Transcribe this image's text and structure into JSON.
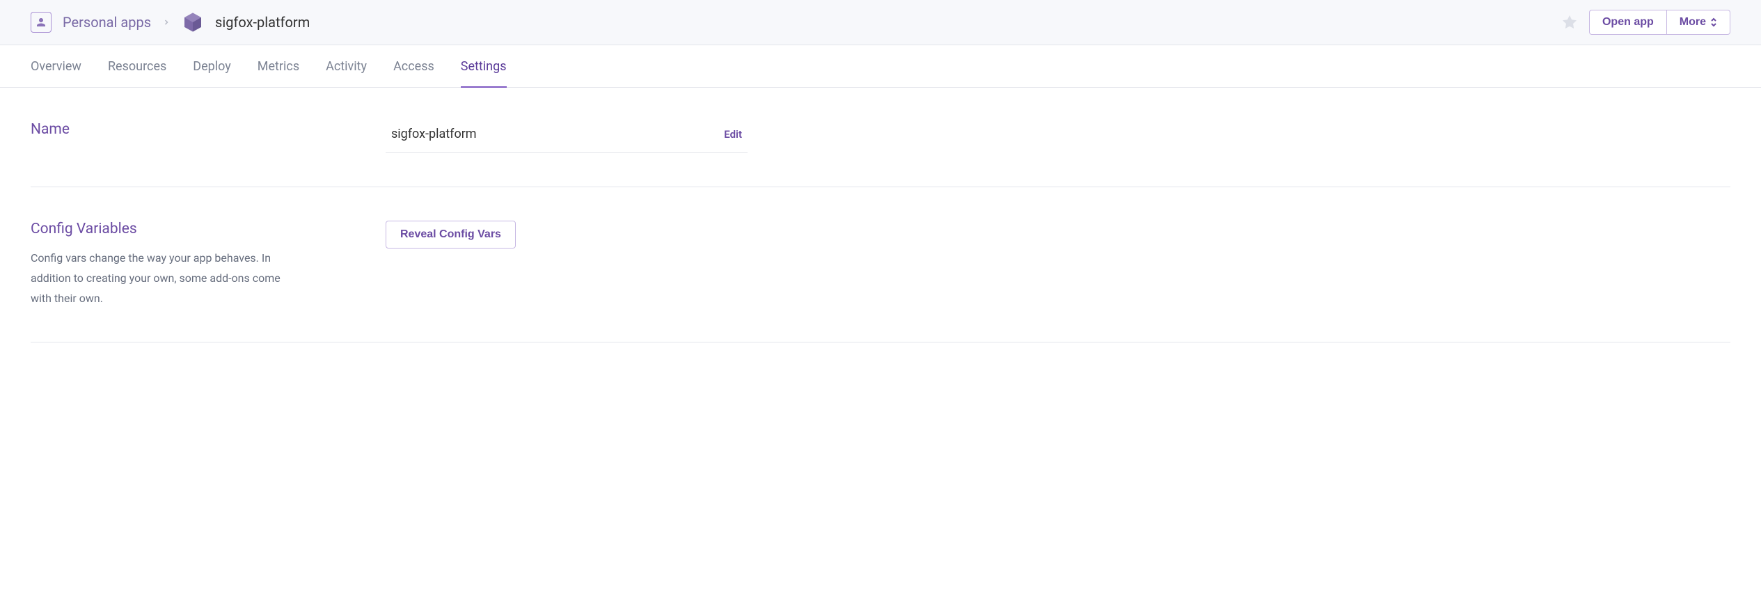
{
  "header": {
    "breadcrumb": {
      "personal_label": "Personal apps",
      "app_name": "sigfox-platform"
    },
    "actions": {
      "open_app_label": "Open app",
      "more_label": "More"
    }
  },
  "tabs": [
    {
      "label": "Overview",
      "active": false
    },
    {
      "label": "Resources",
      "active": false
    },
    {
      "label": "Deploy",
      "active": false
    },
    {
      "label": "Metrics",
      "active": false
    },
    {
      "label": "Activity",
      "active": false
    },
    {
      "label": "Access",
      "active": false
    },
    {
      "label": "Settings",
      "active": true
    }
  ],
  "sections": {
    "name": {
      "title": "Name",
      "value": "sigfox-platform",
      "edit_label": "Edit"
    },
    "config": {
      "title": "Config Variables",
      "description": "Config vars change the way your app behaves. In addition to creating your own, some add-ons come with their own.",
      "reveal_label": "Reveal Config Vars"
    }
  }
}
